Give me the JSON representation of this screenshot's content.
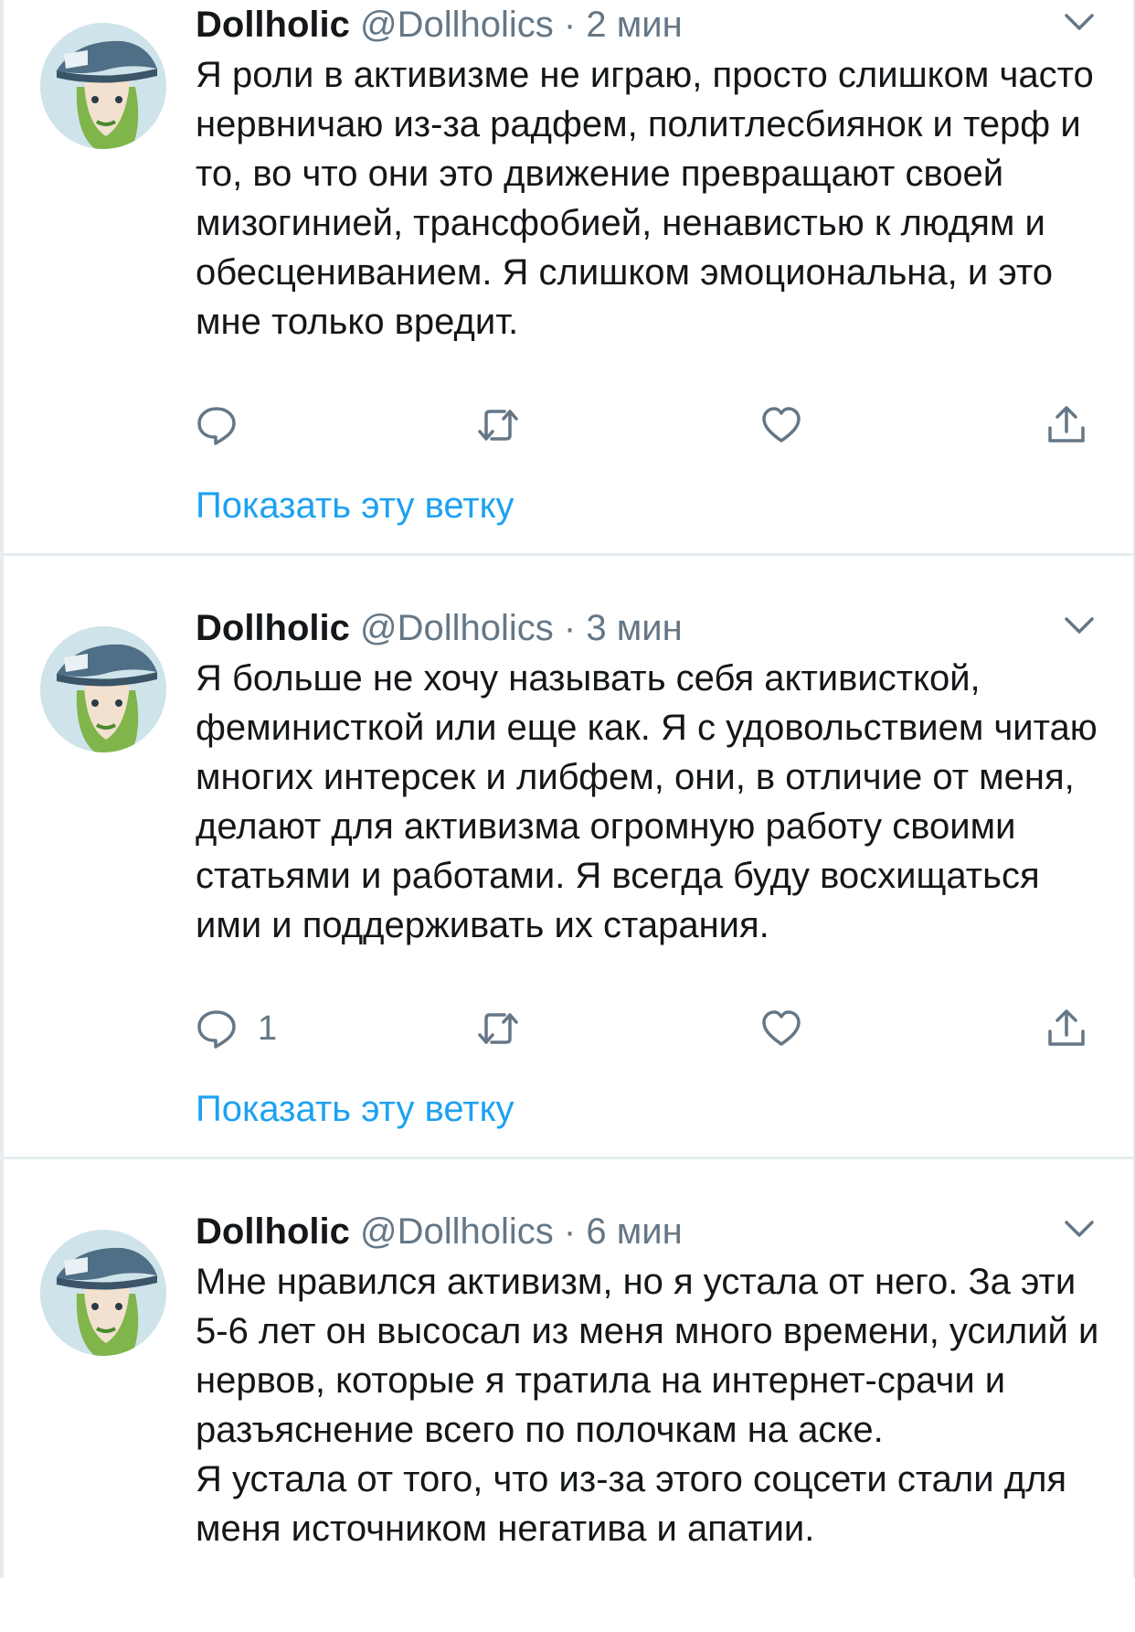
{
  "colors": {
    "name": "#14171a",
    "meta": "#657786",
    "link": "#1da1f2",
    "divider": "#e6ecf0"
  },
  "icons": {
    "reply": "reply-icon",
    "retweet": "retweet-icon",
    "like": "heart-icon",
    "share": "share-icon",
    "more": "chevron-down-icon"
  },
  "tweets": [
    {
      "name": "Dollholic",
      "handle": "@Dollholics",
      "separator": "·",
      "time": "2 мин",
      "lines": [
        "Я роли в активизме не играю, просто слишком часто нервничаю из-за радфем, политлесбиянок и терф и то, во что они это движение превращают своей мизогинией, трансфобией, ненавистью к людям и обесцениванием. Я слишком эмоциональна, и это мне только вредит."
      ],
      "reply_count": "",
      "show_thread": "Показать эту ветку"
    },
    {
      "name": "Dollholic",
      "handle": "@Dollholics",
      "separator": "·",
      "time": "3 мин",
      "lines": [
        "Я больше не хочу называть себя активисткой, феминисткой или еще как. Я с удовольствием читаю многих интерсек и либфем, они,  в отличие от меня, делают для активизма огромную работу своими статьями и работами. Я всегда буду восхищаться ими и поддерживать их старания."
      ],
      "reply_count": "1",
      "show_thread": "Показать эту ветку"
    },
    {
      "name": "Dollholic",
      "handle": "@Dollholics",
      "separator": "·",
      "time": "6 мин",
      "lines": [
        "Мне нравился активизм, но я устала от него. За эти 5-6 лет он высосал из меня много времени, усилий и нервов, которые я тратила на интернет-срачи и разъяснение всего по полочкам на аске.",
        "Я устала от того, что из-за этого соцсети стали для меня источником негатива и апатии."
      ],
      "reply_count": "",
      "show_thread": ""
    }
  ]
}
